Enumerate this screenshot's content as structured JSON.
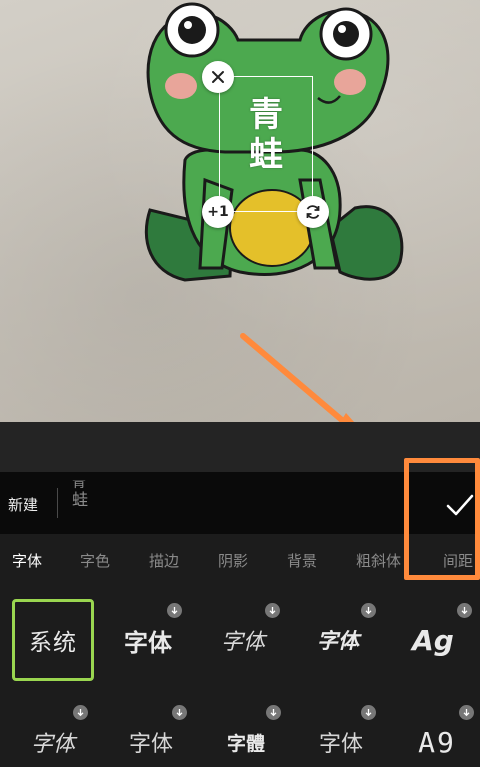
{
  "canvas": {
    "text_line1": "青",
    "text_line2": "蛙",
    "duplicate_label": "+1",
    "close_icon": "close-icon",
    "rotate_icon": "rotate-icon"
  },
  "input": {
    "new_label": "新建",
    "draft_line1": "青",
    "draft_line2": "蛙",
    "confirm_icon": "checkmark-icon"
  },
  "tabs": [
    {
      "label": "字体",
      "active": true
    },
    {
      "label": "字色",
      "active": false
    },
    {
      "label": "描边",
      "active": false
    },
    {
      "label": "阴影",
      "active": false
    },
    {
      "label": "背景",
      "active": false
    },
    {
      "label": "粗斜体",
      "active": false
    },
    {
      "label": "间距",
      "active": false
    }
  ],
  "fonts": [
    {
      "sample": "系统",
      "selected": true,
      "download": false
    },
    {
      "sample": "字体",
      "selected": false,
      "download": true
    },
    {
      "sample": "字体",
      "selected": false,
      "download": true
    },
    {
      "sample": "字体",
      "selected": false,
      "download": true
    },
    {
      "sample": "Ag",
      "selected": false,
      "download": true
    },
    {
      "sample": "字体",
      "selected": false,
      "download": true
    },
    {
      "sample": "字体",
      "selected": false,
      "download": true
    },
    {
      "sample": "字體",
      "selected": false,
      "download": true
    },
    {
      "sample": "字体",
      "selected": false,
      "download": true
    },
    {
      "sample": "A9",
      "selected": false,
      "download": true
    }
  ],
  "colors": {
    "accent_highlight": "#ff8a3c",
    "selected_border": "#9ad650",
    "panel_bg": "#1c1c1c"
  }
}
